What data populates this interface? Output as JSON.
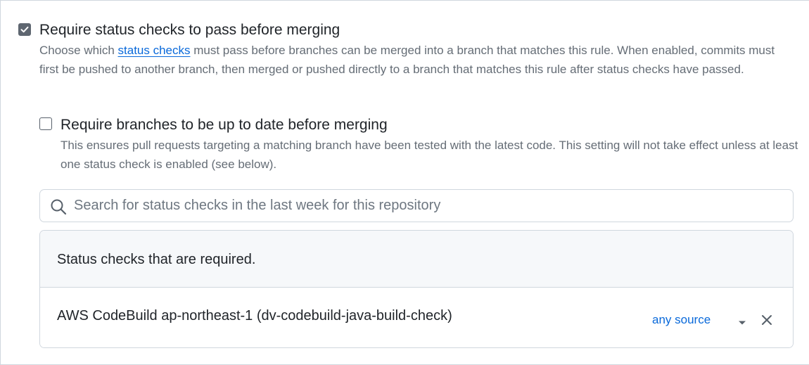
{
  "status_checks_rule": {
    "checked": true,
    "title": "Require status checks to pass before merging",
    "desc_before": "Choose which ",
    "desc_link": "status checks",
    "desc_after": " must pass before branches can be merged into a branch that matches this rule. When enabled, commits must first be pushed to another branch, then merged or pushed directly to a branch that matches this rule after status checks have passed."
  },
  "up_to_date_rule": {
    "checked": false,
    "title": "Require branches to be up to date before merging",
    "desc": "This ensures pull requests targeting a matching branch have been tested with the latest code. This setting will not take effect unless at least one status check is enabled (see below)."
  },
  "search": {
    "placeholder": "Search for status checks in the last week for this repository",
    "value": "",
    "icon": "search-icon"
  },
  "required_checks": {
    "header": "Status checks that are required.",
    "items": [
      {
        "name": "AWS CodeBuild ap-northeast-1 (dv-codebuild-java-build-check)",
        "source": "any source"
      }
    ]
  },
  "colors": {
    "link": "#0969da",
    "muted_text": "#656d76",
    "border": "#d0d7de",
    "header_bg": "#f6f8fa",
    "checkbox_checked": "#5e6670"
  }
}
